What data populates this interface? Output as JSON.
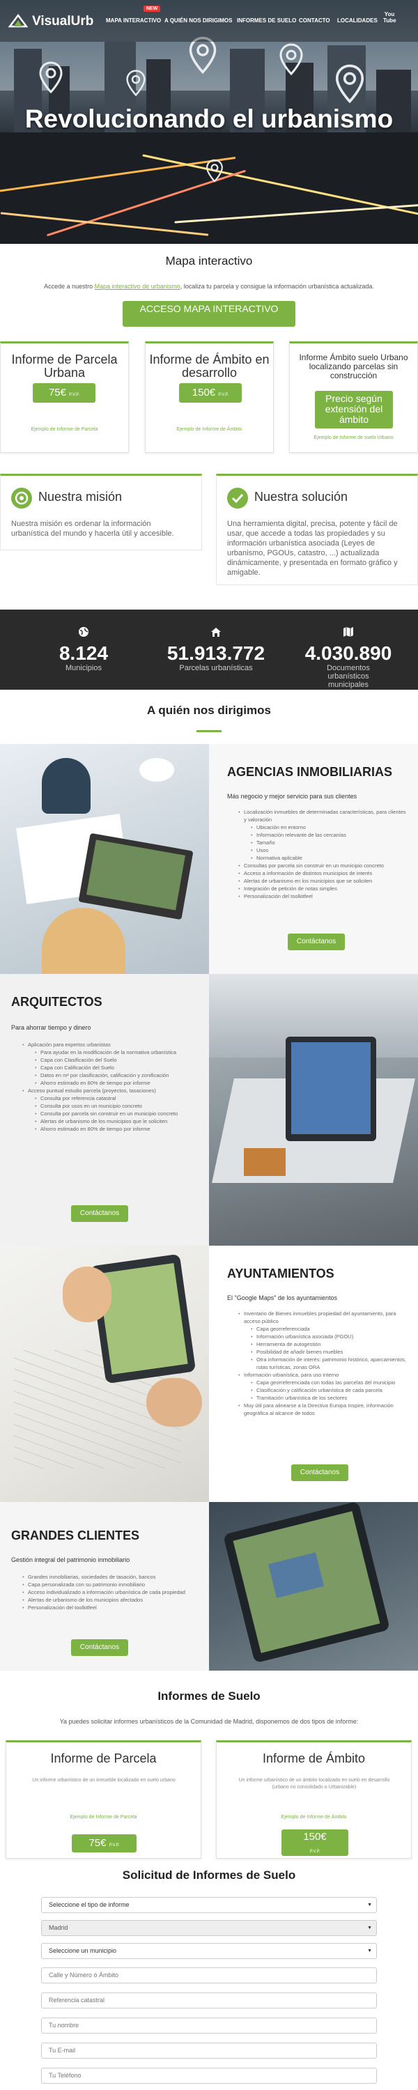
{
  "nav": {
    "logo": "VisualUrb",
    "badge": "NEW",
    "items": [
      "MAPA INTERACTIVO",
      "A QUIÉN NOS DIRIGIMOS",
      "INFORMES DE SUELO",
      "CONTACTO",
      "LOCALIDADES"
    ],
    "youtube": "You Tube"
  },
  "hero": {
    "title": "Revolucionando el urbanismo"
  },
  "mapa": {
    "title": "Mapa interactivo",
    "text_before": "Accede a nuestro ",
    "link": "Mapa interactivo de urbanismo",
    "text_after": ", localiza tu parcela y consigue la información urbanística actualizada.",
    "button": "ACCESO MAPA INTERACTIVO"
  },
  "cards": [
    {
      "title": "Informe de Parcela Urbana",
      "price": "75€",
      "unit": "P.V.P.",
      "link": "Ejemplo de Informe de Parcela"
    },
    {
      "title": "Informe de Ámbito en desarrollo",
      "price": "150€",
      "unit": "P.V.P.",
      "link": "Ejemplo de Informe de Ámbito"
    },
    {
      "title": "Informe Ámbito suelo Urbano localizando parcelas sin construcción",
      "button": "Precio según extensión del ámbito",
      "link": "Ejemplo de Informe de suelo Urbano"
    }
  ],
  "mision": {
    "title": "Nuestra misión",
    "text": "Nuestra misión es ordenar la información urbanística del mundo y hacerla útil y accesible."
  },
  "solucion": {
    "title": "Nuestra solución",
    "text": "Una herramienta digital, precisa, potente y fácil de usar, que accede a todas las propiedades y su información urbanística asociada (Leyes de urbanismo, PGOUs, catastro, ...) actualizada dinámicamente, y presentada en formato gráfico y amigable."
  },
  "stats": [
    {
      "num": "8.124",
      "label": "Municipios",
      "icon": "globe-icon"
    },
    {
      "num": "51.913.772",
      "label": "Parcelas urbanísticas",
      "icon": "home-icon"
    },
    {
      "num": "4.030.890",
      "label": "Documentos urbanísticos municipales",
      "icon": "map-icon"
    }
  ],
  "dirigimos": {
    "title": "A quién nos dirigimos"
  },
  "agencias": {
    "title": "AGENCIAS INMOBILIARIAS",
    "sub": "Más negocio y mejor servicio para sus clientes",
    "items": [
      {
        "t": "Localización inmuebles de determinadas características, para clientes y valoración",
        "l": 1
      },
      {
        "t": "Ubicación en entorno",
        "l": 2
      },
      {
        "t": "Información relevante de las cercanías",
        "l": 2
      },
      {
        "t": "Tamaño",
        "l": 2
      },
      {
        "t": "Usos",
        "l": 2
      },
      {
        "t": "Normativa aplicable",
        "l": 2
      },
      {
        "t": "Consultas por parcela sin construir en un municipio concreto",
        "l": 1
      },
      {
        "t": "Acceso a información de distintos municipios de interés",
        "l": 1
      },
      {
        "t": "Alertas de urbanismo en los municipios que se soliciten",
        "l": 1
      },
      {
        "t": "Integración de petición de notas simples",
        "l": 1
      },
      {
        "t": "Personalización del toolkitfeel",
        "l": 1
      }
    ],
    "button": "Contáctanos"
  },
  "arquitectos": {
    "title": "ARQUITECTOS",
    "sub": "Para ahorrar tiempo y dinero",
    "items": [
      {
        "t": "Aplicación para expertos urbanistas",
        "l": 1
      },
      {
        "t": "Para ayudar en la modificación de la normativa urbanística",
        "l": 2
      },
      {
        "t": "Capa con Clasificación del Suelo",
        "l": 2
      },
      {
        "t": "Capa con Calificación del Suelo",
        "l": 2
      },
      {
        "t": "Datos en m² por clasificación, calificación y zonificación",
        "l": 2
      },
      {
        "t": "Ahorro estimado en 80% de tiempo por informe",
        "l": 2
      },
      {
        "t": "Acceso puntual estudio parcela (proyectos, tasaciones)",
        "l": 1
      },
      {
        "t": "Consulta por referencia catastral",
        "l": 2
      },
      {
        "t": "Consulta por usos en un municipio concreto",
        "l": 2
      },
      {
        "t": "Consulta por parcela sin construir en un municipio concreto",
        "l": 2
      },
      {
        "t": "Alertas de urbanismo de los municipios que le soliciten",
        "l": 2
      },
      {
        "t": "Ahorro estimado en 80% de tiempo por informe",
        "l": 2
      }
    ],
    "button": "Contáctanos"
  },
  "ayuntamientos": {
    "title": "AYUNTAMIENTOS",
    "sub": "El \"Google Maps\" de los ayuntamientos",
    "items": [
      {
        "t": "Inventario de Bienes inmuebles propiedad del ayuntamiento, para acceso público",
        "l": 1
      },
      {
        "t": "Capa georreferenciada",
        "l": 2
      },
      {
        "t": "Información urbanística asociada (PGOU)",
        "l": 2
      },
      {
        "t": "Herramienta de autogestión",
        "l": 2
      },
      {
        "t": "Posibilidad de añadir bienes muebles",
        "l": 2
      },
      {
        "t": "Otra información de interés: patrimonio histórico, aparcamientos, rutas turísticas, zonas ORA",
        "l": 2
      },
      {
        "t": "Información urbanística, para uso interno",
        "l": 1
      },
      {
        "t": "Capa georreferenciada con todas las parcelas del municipio",
        "l": 2
      },
      {
        "t": "Clasificación y calificación urbanística de cada parcela",
        "l": 2
      },
      {
        "t": "Tramitación urbanística de los sectores",
        "l": 2
      },
      {
        "t": "Muy útil para alinearse a la Directiva Europa Inspire, información geográfica al alcance de todos",
        "l": 1
      }
    ],
    "button": "Contáctanos"
  },
  "grandes": {
    "title": "GRANDES CLIENTES",
    "sub": "Gestión integral del patrimonio inmobiliario",
    "items": [
      {
        "t": "Grandes inmobiliarias, sociedades de tasación, bancos",
        "l": 1
      },
      {
        "t": "Capa personalizada con su patrimonio inmobiliario",
        "l": 1
      },
      {
        "t": "Acceso individualizado a información urbanística de cada propiedad",
        "l": 1
      },
      {
        "t": "Alertas de urbanismo de los municipios afectados",
        "l": 1
      },
      {
        "t": "Personalización del toolkitfeel",
        "l": 1
      }
    ],
    "button": "Contáctanos"
  },
  "informes": {
    "title": "Informes de Suelo",
    "text": "Ya puedes solicitar informes urbanísticos de la Comunidad de Madrid, disponemos de dos tipos de informe:",
    "cards": [
      {
        "title": "Informe de Parcela",
        "desc": "Un informe urbanístico de un inmueble localizado en suelo urbano",
        "link": "Ejemplo de Informe de Parcela",
        "price": "75€",
        "unit": "P.V.P."
      },
      {
        "title": "Informe de Ámbito",
        "desc": "Un informe urbanístico de un ámbito localizado en suelo en desarrollo (urbano no consolidado o Urbanizable)",
        "link": "Ejemplo de Informe de Ámbito",
        "price": "150€",
        "unit": "P.V.P."
      }
    ]
  },
  "solicitud": {
    "title": "Solicitud de Informes de Suelo",
    "fields": [
      {
        "v": "Seleccione el tipo de informe",
        "kind": "select"
      },
      {
        "v": "Madrid",
        "kind": "select-gray"
      },
      {
        "v": "Seleccione un municipio",
        "kind": "select"
      },
      {
        "v": "Calle y Número ó Ámbito",
        "kind": "input"
      },
      {
        "v": "Referencia catastral",
        "kind": "input"
      },
      {
        "v": "Tu nombre",
        "kind": "input"
      },
      {
        "v": "Tu E-mail",
        "kind": "input"
      },
      {
        "v": "Tu Teléfono",
        "kind": "input"
      }
    ]
  }
}
